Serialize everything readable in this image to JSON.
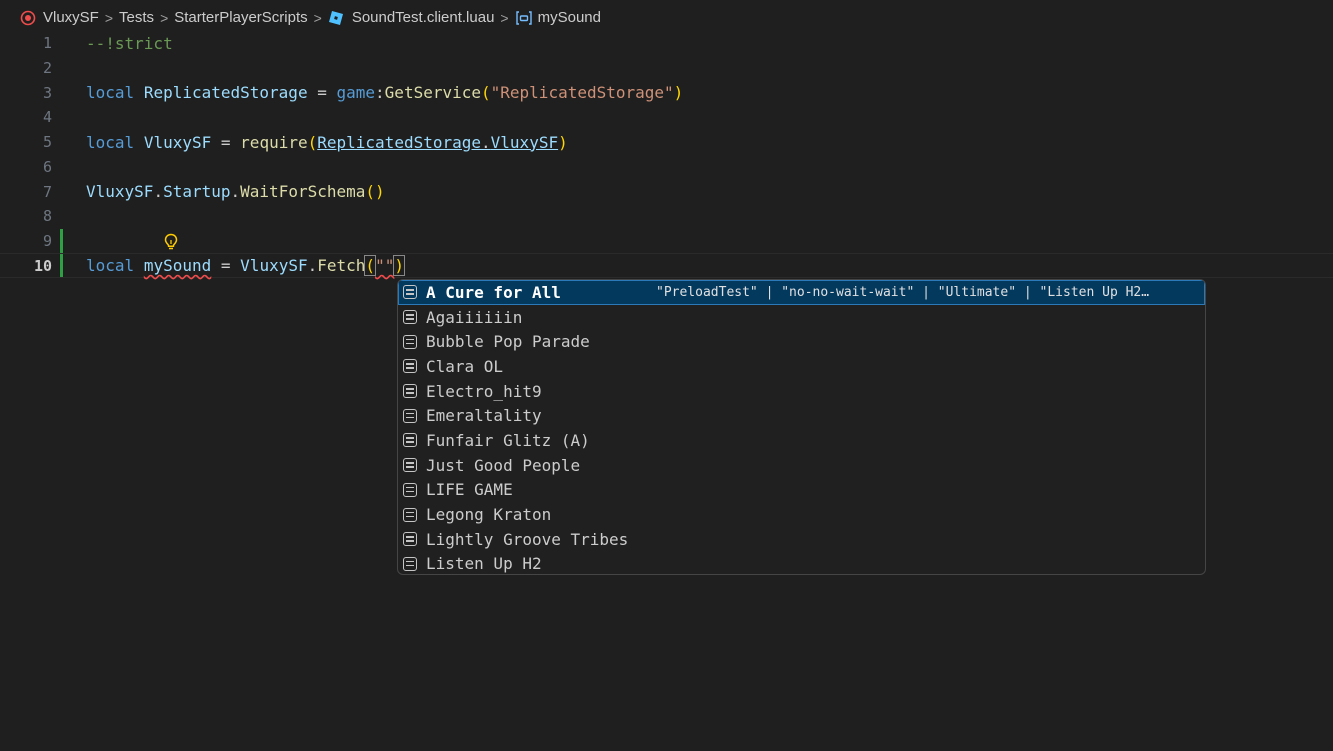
{
  "breadcrumb": {
    "items": [
      "VluxySF",
      "Tests",
      "StarterPlayerScripts",
      "SoundTest.client.luau",
      "mySound"
    ],
    "separator": ">"
  },
  "lines": [
    {
      "n": "1",
      "tokens": [
        "--!strict"
      ]
    },
    {
      "n": "2",
      "tokens": []
    },
    {
      "n": "3",
      "tokens": [
        "local",
        "ReplicatedStorage",
        "=",
        "game",
        ":",
        "GetService",
        "(",
        "\"ReplicatedStorage\"",
        ")"
      ]
    },
    {
      "n": "4",
      "tokens": []
    },
    {
      "n": "5",
      "tokens": [
        "local",
        "VluxySF",
        "=",
        "require",
        "(",
        "ReplicatedStorage",
        ".",
        "VluxySF",
        ")"
      ]
    },
    {
      "n": "6",
      "tokens": []
    },
    {
      "n": "7",
      "tokens": [
        "VluxySF",
        ".",
        "Startup",
        ".",
        "WaitForSchema",
        "()"
      ]
    },
    {
      "n": "8",
      "tokens": []
    },
    {
      "n": "9",
      "tokens": []
    },
    {
      "n": "10",
      "tokens": [
        "local",
        "mySound",
        "=",
        "VluxySF",
        ".",
        "Fetch",
        "(",
        "\"\"",
        ")"
      ]
    }
  ],
  "suggest": {
    "selected_detail": "\"PreloadTest\" | \"no-no-wait-wait\" | \"Ultimate\" | \"Listen Up H2…",
    "items": [
      "A Cure for All",
      "Agaiiiiiin",
      "Bubble Pop Parade",
      "Clara OL",
      "Electro_hit9",
      "Emeraltality",
      "Funfair Glitz (A)",
      "Just Good People",
      "LIFE GAME",
      "Legong Kraton",
      "Lightly Groove Tribes",
      "Listen Up H2"
    ]
  },
  "icons": {
    "breadcrumb_root": "target-icon",
    "file": "roblox-icon",
    "symbol": "variable-icon",
    "lightbulb": "lightbulb-icon",
    "completion_kind": "enum-member-icon"
  },
  "colors": {
    "background": "#1f1f1f",
    "keyword": "#569cd6",
    "comment": "#6a9955",
    "variable": "#9cdcfe",
    "function": "#dcdcaa",
    "string": "#ce9178",
    "selection": "#04395e",
    "modified_gutter": "#2ea043"
  }
}
